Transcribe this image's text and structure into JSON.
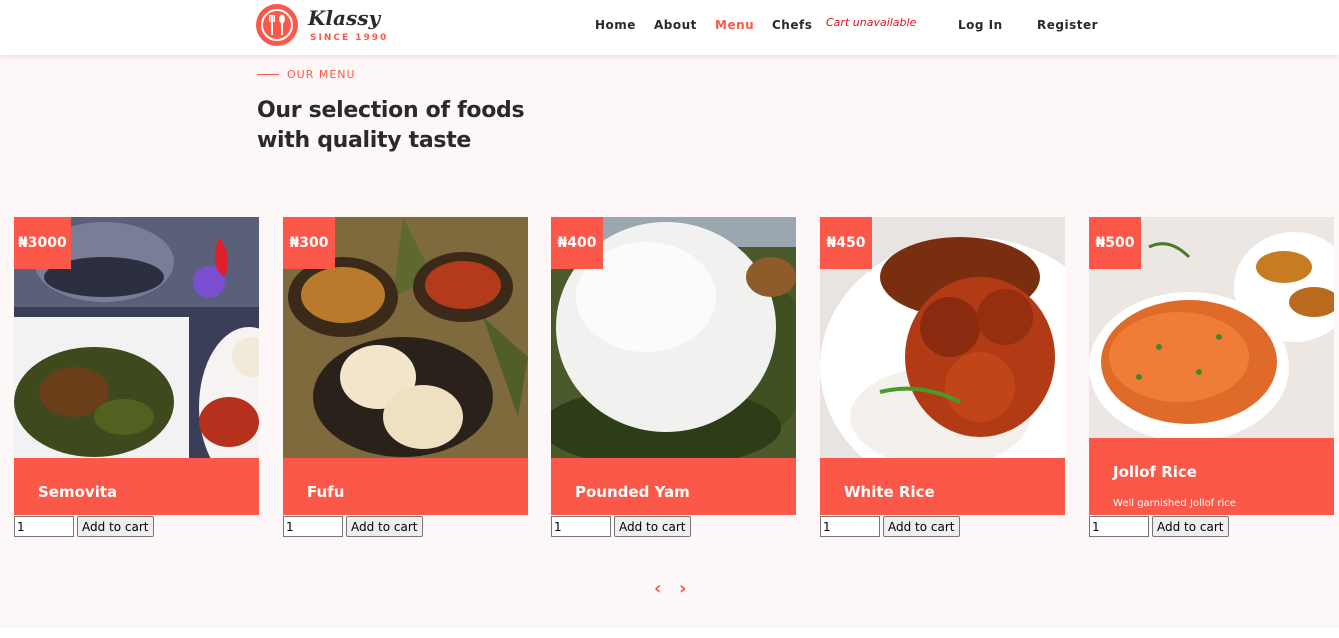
{
  "header": {
    "logo_name": "Klassy",
    "logo_since": "SINCE 1990",
    "nav": [
      "Home",
      "About",
      "Menu",
      "Chefs"
    ],
    "nav_active": "Menu",
    "cart_status": "Cart unavailable",
    "login": "Log In",
    "register": "Register"
  },
  "menu": {
    "eyebrow": "OUR MENU",
    "heading_line1": "Our selection of foods",
    "heading_line2": "with quality taste"
  },
  "items": [
    {
      "price": "₦3000",
      "name": "Semovita",
      "description": "",
      "qty": "1",
      "button": "Add to cart"
    },
    {
      "price": "₦300",
      "name": "Fufu",
      "description": "",
      "qty": "1",
      "button": "Add to cart"
    },
    {
      "price": "₦400",
      "name": "Pounded Yam",
      "description": "",
      "qty": "1",
      "button": "Add to cart"
    },
    {
      "price": "₦450",
      "name": "White Rice",
      "description": "",
      "qty": "1",
      "button": "Add to cart"
    },
    {
      "price": "₦500",
      "name": "Jollof Rice",
      "description": "Well garnished Jollof rice",
      "qty": "1",
      "button": "Add to cart"
    }
  ],
  "carousel": {
    "prev_icon": "chevron-left-icon",
    "next_icon": "chevron-right-icon"
  },
  "colors": {
    "accent": "#fb5849",
    "section_bg": "#fdf8f7",
    "cart_status": "#e0111c"
  }
}
